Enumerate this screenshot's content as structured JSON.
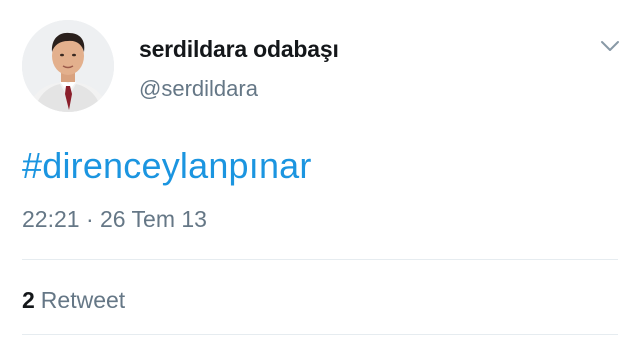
{
  "tweet": {
    "user": {
      "display_name": "serdildara odabaşı",
      "handle": "@serdildara",
      "avatar_icon": "person-photo-avatar"
    },
    "menu_icon": "chevron-down-icon",
    "text": "#direnceylanpınar",
    "timestamp": "22:21 · 26 Tem 13",
    "stats": {
      "retweet_count": "2",
      "retweet_label": "Retweet"
    }
  },
  "colors": {
    "link": "#1b95e0",
    "secondary_text": "#657786",
    "primary_text": "#14171a",
    "divider": "#e6ecf0"
  }
}
